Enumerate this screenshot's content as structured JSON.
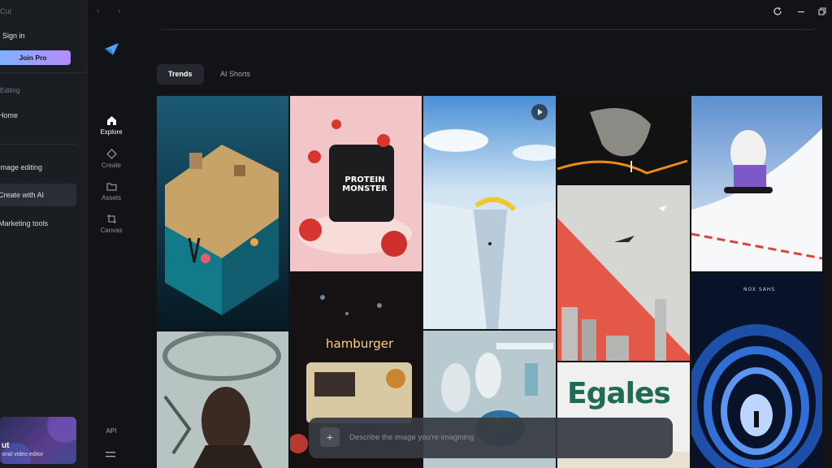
{
  "drawer": {
    "brand": "Cut",
    "sign_in": "Sign in",
    "join_pro": "Join Pro",
    "section_label": "Editing",
    "items": [
      {
        "label": "Home"
      },
      {
        "label": "Image editing"
      },
      {
        "label": "Create with AI"
      },
      {
        "label": "Marketing tools"
      }
    ],
    "promo": {
      "title": "ut",
      "subtitle": "onal video editor"
    }
  },
  "rail": {
    "items": [
      {
        "label": "Explore",
        "icon": "home-icon"
      },
      {
        "label": "Create",
        "icon": "diamond-icon"
      },
      {
        "label": "Assets",
        "icon": "folder-icon"
      },
      {
        "label": "Canvas",
        "icon": "crop-icon"
      }
    ],
    "api": "API"
  },
  "tabs": [
    {
      "label": "Trends"
    },
    {
      "label": "AI Shorts"
    }
  ],
  "gallery": {
    "protein_text": "PROTEIN MONSTER",
    "hamburger_text": "hamburger",
    "egales_text": "Egales",
    "poster_text": "NOX SAHS"
  },
  "prompt": {
    "placeholder": "Describe the image you're imagining"
  },
  "colors": {
    "accent_gradient_start": "#7db4ff",
    "accent_gradient_end": "#b58cff",
    "background": "#121317"
  }
}
